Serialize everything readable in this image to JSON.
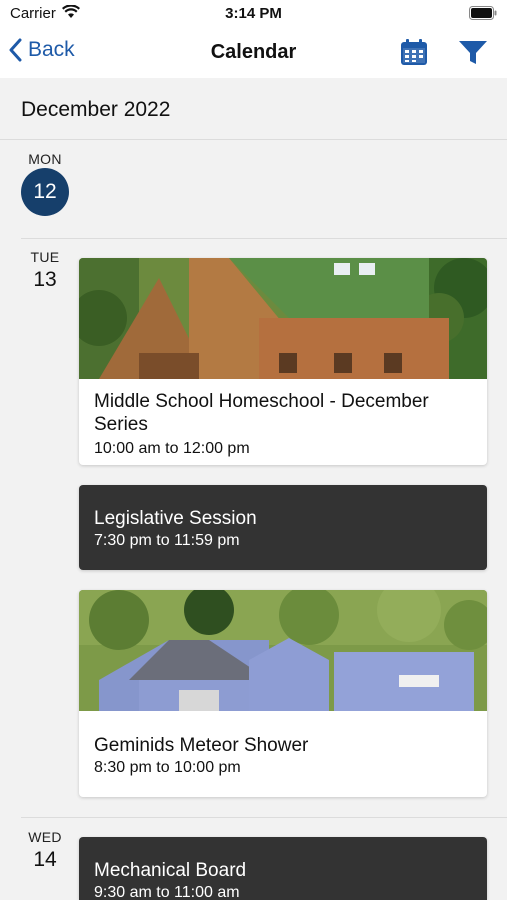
{
  "status": {
    "carrier": "Carrier",
    "time": "3:14 PM"
  },
  "nav": {
    "back_label": "Back",
    "title": "Calendar",
    "calendar_icon": "calendar-icon",
    "filter_icon": "filter-icon"
  },
  "month_header": "December 2022",
  "days": [
    {
      "dow": "MON",
      "date": "12",
      "selected": true
    },
    {
      "dow": "TUE",
      "date": "13",
      "selected": false
    },
    {
      "dow": "WED",
      "date": "14",
      "selected": false
    }
  ],
  "events": [
    {
      "title": "Middle School Homeschool - December Series",
      "time": "10:00 am to 12:00 pm",
      "style": "image",
      "image": "wooden lodge with green roof"
    },
    {
      "title": "Legislative Session",
      "time": "7:30 pm to 11:59 pm",
      "style": "dark"
    },
    {
      "title": "Geminids Meteor Shower",
      "time": "8:30 pm to 10:00 pm",
      "style": "image",
      "image": "blue buildings among trees"
    },
    {
      "title": "Mechanical Board",
      "time": "9:30 am to 11:00 am",
      "style": "dark"
    }
  ],
  "colors": {
    "accent": "#1e5aa8",
    "selected_day": "#163f6b",
    "dark_card": "#333333"
  }
}
